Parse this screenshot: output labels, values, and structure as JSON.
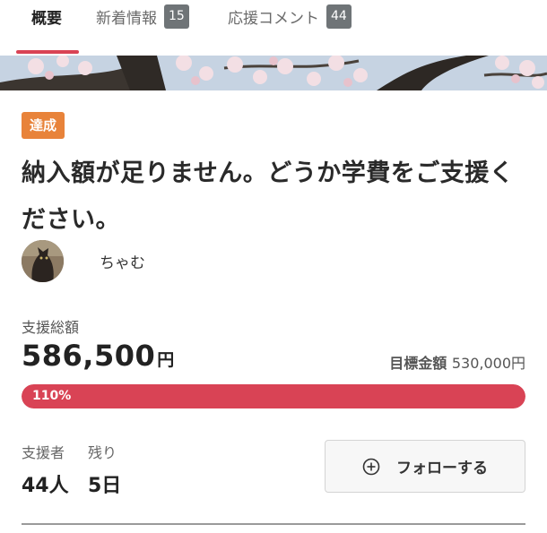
{
  "tabs": [
    {
      "label": "概要",
      "badge": null
    },
    {
      "label": "新着情報",
      "badge": "15"
    },
    {
      "label": "応援コメント",
      "badge": "44"
    }
  ],
  "project": {
    "status_badge": "達成",
    "title": "納入額が足りません。どうか学費をご支援ください。",
    "author_name": "ちゃむ"
  },
  "funding": {
    "total_label": "支援総額",
    "total_amount": "586,500",
    "total_unit": "円",
    "target_label": "目標金額",
    "target_value": "530,000円",
    "progress_text": "110%",
    "progress_fraction": 1.0
  },
  "stats": {
    "supporters_label": "支援者",
    "supporters_value": "44人",
    "remaining_label": "残り",
    "remaining_value": "5日"
  },
  "follow_button": {
    "label": "フォローする",
    "icon": "plus-circle-icon"
  },
  "colors": {
    "accent": "#d94355",
    "badge_orange": "#e8833a",
    "tab_badge": "#6f7477"
  }
}
